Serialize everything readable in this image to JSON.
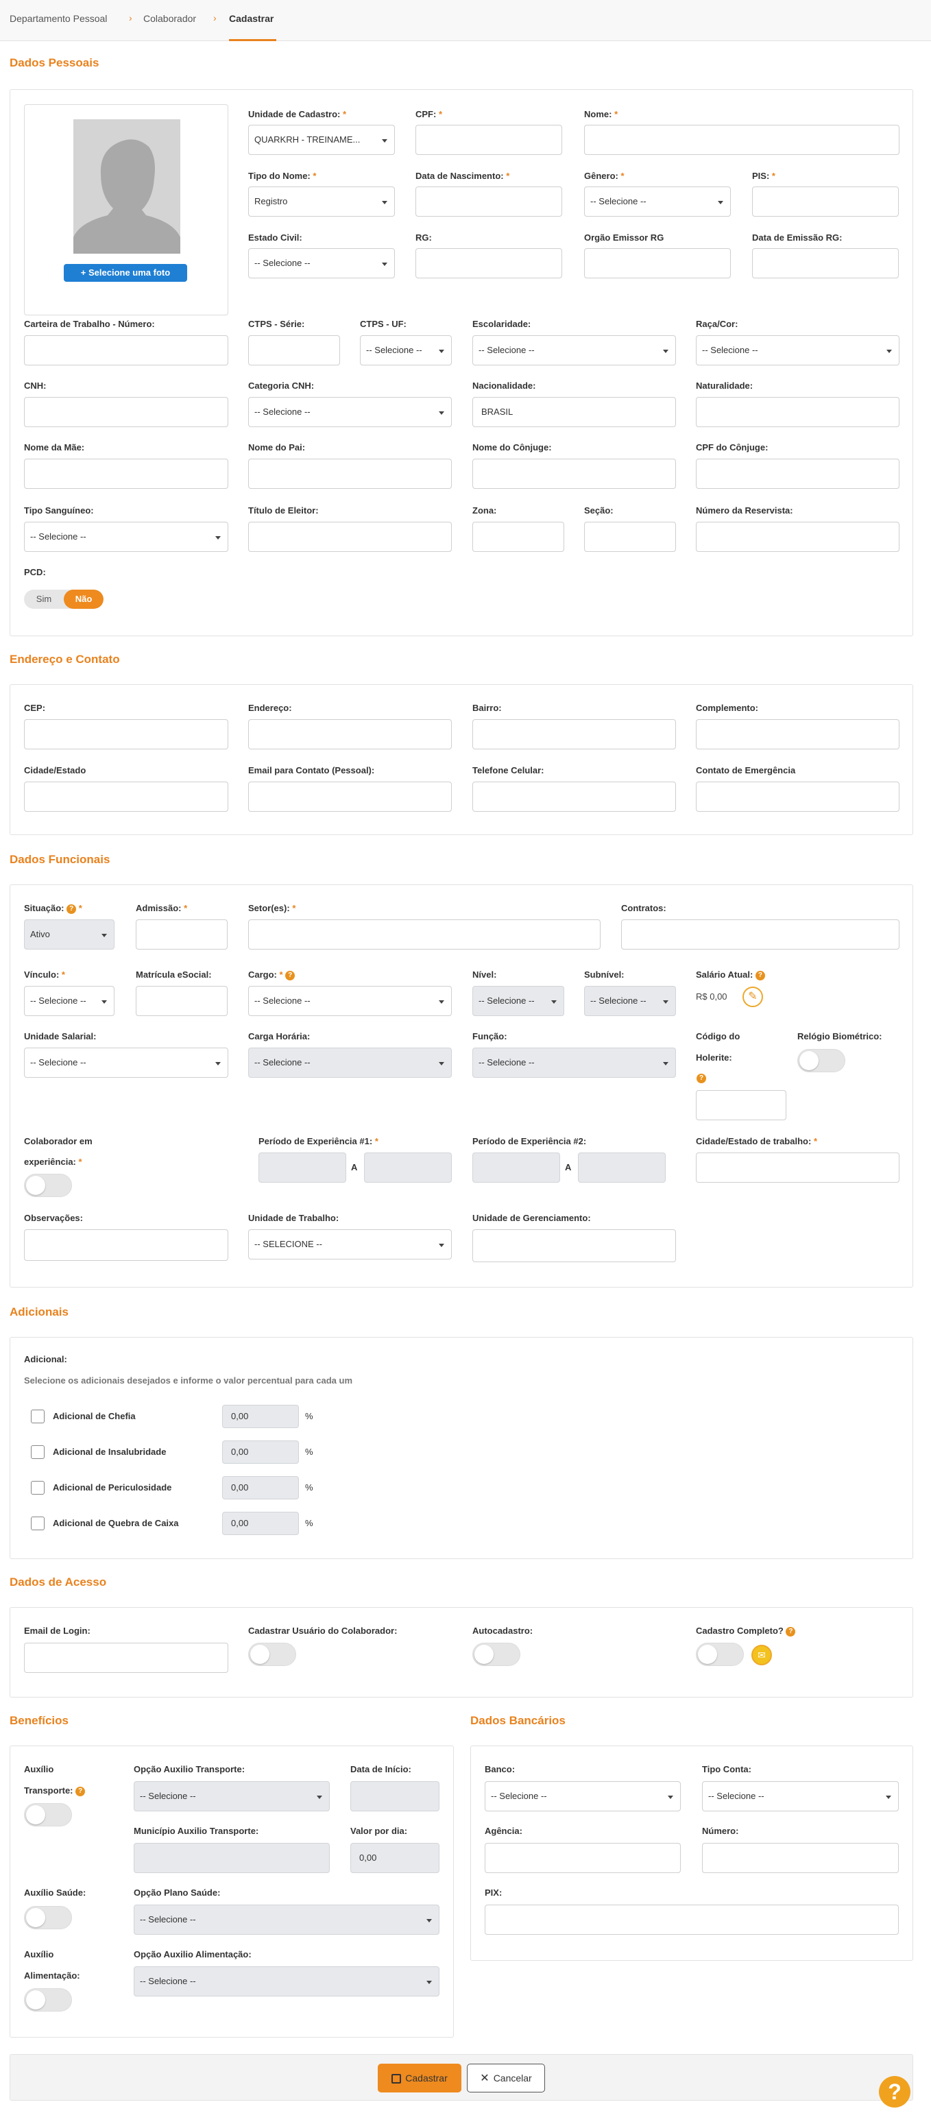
{
  "breadcrumb": {
    "item1": "Departamento Pessoal",
    "item2": "Colaborador",
    "item3": "Cadastrar"
  },
  "sections": {
    "pessoais": "Dados Pessoais",
    "endereco": "Endereço e Contato",
    "funcionais": "Dados Funcionais",
    "adicionais": "Adicionais",
    "acesso": "Dados de Acesso",
    "beneficios": "Benefícios",
    "bancarios": "Dados Bancários"
  },
  "pessoais": {
    "photo_button": "Selecione uma foto",
    "unidade_label": "Unidade de Cadastro:",
    "unidade_value": "QUARKRH - TREINAME...",
    "cpf_label": "CPF:",
    "nome_label": "Nome:",
    "tipo_nome_label": "Tipo do Nome:",
    "tipo_nome_value": "Registro",
    "nascimento_label": "Data de Nascimento:",
    "genero_label": "Gênero:",
    "genero_value": "-- Selecione --",
    "pis_label": "PIS:",
    "estado_civil_label": "Estado Civil:",
    "estado_civil_value": "-- Selecione --",
    "rg_label": "RG:",
    "orgao_label": "Orgão Emissor RG",
    "emissao_label": "Data de Emissão RG:",
    "ctps_num_label": "Carteira de Trabalho - Número:",
    "ctps_serie_label": "CTPS - Série:",
    "ctps_uf_label": "CTPS - UF:",
    "ctps_uf_value": "-- Selecione --",
    "escolaridade_label": "Escolaridade:",
    "escolaridade_value": "-- Selecione --",
    "raca_label": "Raça/Cor:",
    "raca_value": "-- Selecione --",
    "cnh_label": "CNH:",
    "cat_cnh_label": "Categoria CNH:",
    "cat_cnh_value": "-- Selecione --",
    "nacionalidade_label": "Nacionalidade:",
    "nacionalidade_value": "BRASIL",
    "naturalidade_label": "Naturalidade:",
    "mae_label": "Nome da Mãe:",
    "pai_label": "Nome do Pai:",
    "conjuge_label": "Nome do Cônjuge:",
    "cpf_conjuge_label": "CPF do Cônjuge:",
    "sangue_label": "Tipo Sanguíneo:",
    "sangue_value": "-- Selecione --",
    "titulo_label": "Título de Eleitor:",
    "zona_label": "Zona:",
    "secao_label": "Seção:",
    "reservista_label": "Número da Reservista:",
    "pcd_label": "PCD:",
    "pcd_sim": "Sim",
    "pcd_nao": "Não"
  },
  "endereco": {
    "cep": "CEP:",
    "endereco": "Endereço:",
    "bairro": "Bairro:",
    "complemento": "Complemento:",
    "cidade": "Cidade/Estado",
    "email": "Email para Contato (Pessoal):",
    "celular": "Telefone Celular:",
    "emergencia": "Contato de Emergência"
  },
  "funcionais": {
    "situacao_label": "Situação:",
    "situacao_value": "Ativo",
    "admissao_label": "Admissão:",
    "setor_label": "Setor(es):",
    "contratos_label": "Contratos:",
    "vinculo_label": "Vínculo:",
    "vinculo_value": "-- Selecione --",
    "matricula_label": "Matrícula eSocial:",
    "cargo_label": "Cargo:",
    "cargo_value": "-- Selecione --",
    "nivel_label": "Nível:",
    "nivel_value": "-- Selecione --",
    "subnivel_label": "Subnível:",
    "subnivel_value": "-- Selecione --",
    "salario_label": "Salário Atual:",
    "salario_value": "R$ 0,00",
    "unidade_salarial_label": "Unidade Salarial:",
    "unidade_salarial_value": "-- Selecione --",
    "carga_label": "Carga Horária:",
    "carga_value": "-- Selecione --",
    "funcao_label": "Função:",
    "funcao_value": "-- Selecione --",
    "holerite_label1": "Código do",
    "holerite_label2": "Holerite:",
    "biometrico_label": "Relógio Biométrico:",
    "experiencia_label1": "Colaborador em",
    "experiencia_label2": "experiência:",
    "periodo1_label": "Período de Experiência #1:",
    "periodo2_label": "Período de Experiência #2:",
    "a_label": "A",
    "cidade_trabalho_label": "Cidade/Estado de trabalho:",
    "obs_label": "Observações:",
    "unidade_trabalho_label": "Unidade de Trabalho:",
    "unidade_trabalho_value": "-- SELECIONE --",
    "unidade_gerenciamento_label": "Unidade de Gerenciamento:"
  },
  "adicionais": {
    "label": "Adicional:",
    "hint": "Selecione os adicionais desejados e informe o valor percentual para cada um",
    "pct": "%",
    "items": [
      {
        "label": "Adicional de Chefia",
        "value": "0,00"
      },
      {
        "label": "Adicional de Insalubridade",
        "value": "0,00"
      },
      {
        "label": "Adicional de Periculosidade",
        "value": "0,00"
      },
      {
        "label": "Adicional de Quebra de Caixa",
        "value": "0,00"
      }
    ]
  },
  "acesso": {
    "email_label": "Email de Login:",
    "usuario_label": "Cadastrar Usuário do Colaborador:",
    "auto_label": "Autocadastro:",
    "completo_label": "Cadastro Completo?"
  },
  "beneficios": {
    "transporte_label1": "Auxílio",
    "transporte_label2": "Transporte:",
    "opcao_transporte_label": "Opção Auxilio Transporte:",
    "opcao_transporte_value": "-- Selecione --",
    "inicio_label": "Data de Início:",
    "municipio_label": "Município Auxilio Transporte:",
    "valor_dia_label": "Valor por dia:",
    "valor_dia_value": "0,00",
    "saude_label": "Auxílio Saúde:",
    "plano_saude_label": "Opção Plano Saúde:",
    "plano_saude_value": "-- Selecione --",
    "alimentacao_label1": "Auxílio",
    "alimentacao_label2": "Alimentação:",
    "opcao_alimentacao_label": "Opção Auxilio Alimentação:",
    "opcao_alimentacao_value": "-- Selecione --"
  },
  "bancarios": {
    "banco_label": "Banco:",
    "banco_value": "-- Selecione --",
    "tipo_label": "Tipo Conta:",
    "tipo_value": "-- Selecione --",
    "agencia_label": "Agência:",
    "numero_label": "Número:",
    "pix_label": "PIX:"
  },
  "footer": {
    "save": "Cadastrar",
    "cancel": "Cancelar"
  },
  "help": "?",
  "colors": {
    "accent": "#e8821e",
    "primary_blue": "#1f7fd3",
    "disabled_bg": "#e7e9ec"
  }
}
